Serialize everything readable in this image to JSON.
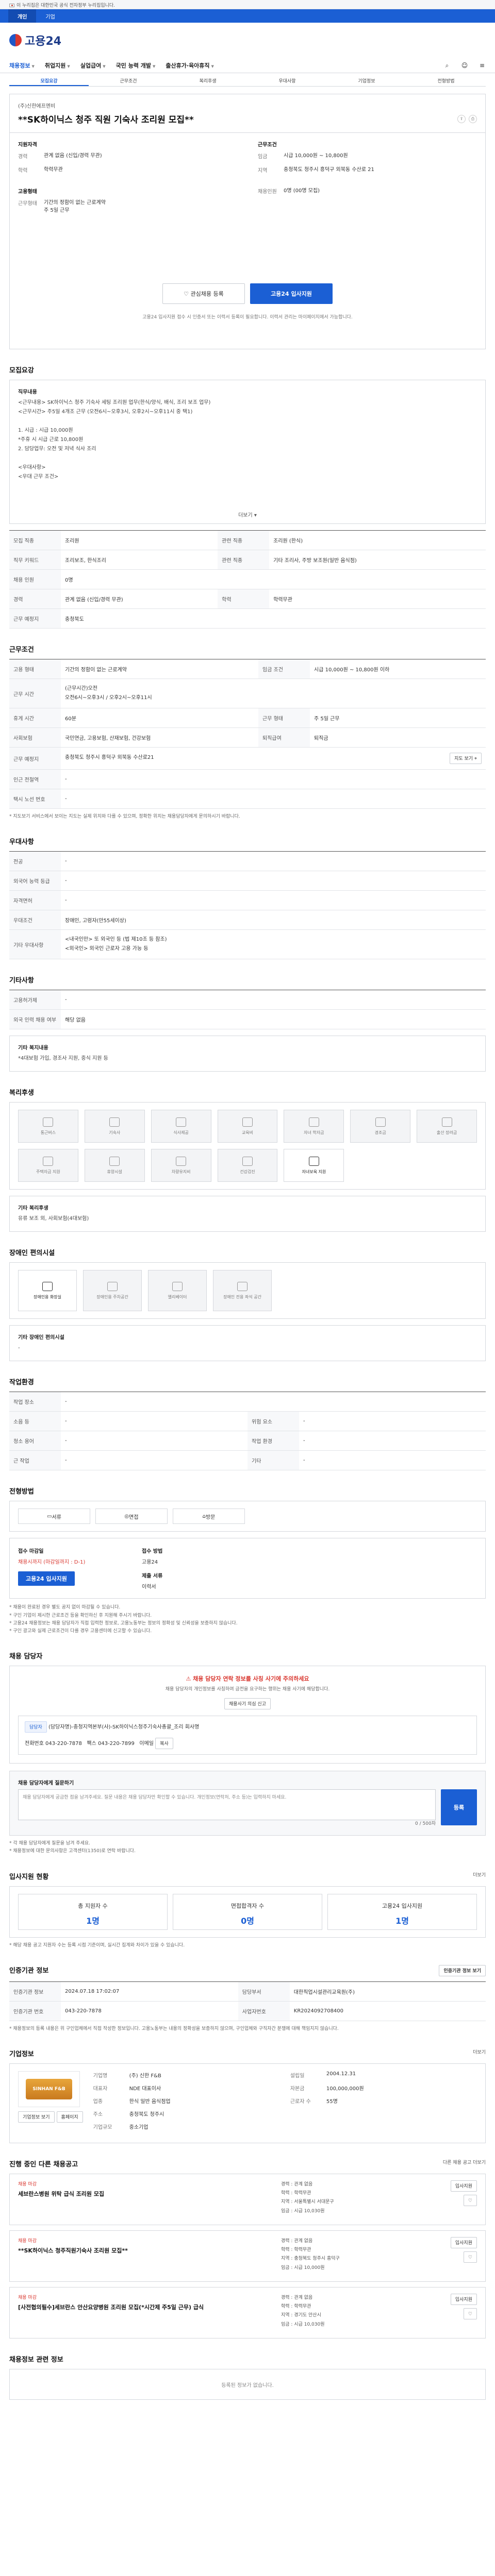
{
  "topbar": {
    "notice": "이 누리집은 대한민국 공식 전자정부 누리집입니다."
  },
  "blue_tabs": [
    "개인",
    "기업"
  ],
  "logo": {
    "text": "고용24"
  },
  "gnb": {
    "items": [
      "채용정보",
      "취업지원",
      "실업급여",
      "국민 능력 개발",
      "출산휴가·육아휴직"
    ],
    "right": [
      "검색",
      "로그인",
      "전체메뉴"
    ]
  },
  "anchor_tabs": [
    "모집요강",
    "근무조건",
    "복리후생",
    "우대사항",
    "기업정보",
    "전형방법"
  ],
  "job": {
    "company": "(주)신한에프엔비",
    "title": "**SK하이닉스 청주 직원 기숙사 조리원 모집**",
    "share": [
      "공유",
      "인쇄"
    ],
    "summary": {
      "left_head": "지원자격",
      "left": [
        {
          "k": "경력",
          "v": "관계 없음 (신입/경력 무관)"
        },
        {
          "k": "학력",
          "v": "학력무관"
        },
        {
          "k": "고용형태",
          "v": ""
        },
        {
          "k": "근무형태",
          "v": "기간의 정함이 없는 근로계약\n주 5일 근무"
        }
      ],
      "right_head": "근무조건",
      "right": [
        {
          "k": "임금",
          "v": "시급 10,000원 ~ 10,800원"
        },
        {
          "k": "지역",
          "v": "충청북도 청주시 흥덕구 외북동 수산로 21"
        },
        {
          "k": "채용인원",
          "v": "0명 (00명 모집)"
        }
      ],
      "bookmark_label": "관심채용 등록",
      "apply_label": "고용24 입사지원",
      "note": "고용24 입사지원 접수 시 인증서 또는 이력서 등록이 필요합니다. 이력서 관리는 마이페이지에서 가능합니다."
    }
  },
  "recruit": {
    "title": "모집요강",
    "duty_label": "직무내용",
    "duty_text": "<근무내용> SK하이닉스 청주 기숙사 세팅 조리원 업무(한식/양식, 배식, 조리 보조 업무)\n<근무시간> 주5일 4개조 근무 (오전6시~오후3시, 오후2시~오후11시 중 택1)\n\n1. 시급 : 시급 10,000원\n   *주휴 시 시급 근로 10,800원\n2. 담당업무: 오전 및 저녁 식사 조리\n\n<우대사항>\n<우대 근무 조건>",
    "more_label": "더보기",
    "rows": [
      [
        {
          "k": "모집 직종",
          "v": "조리원"
        },
        {
          "k": "관련 직종",
          "v": "조리원 (한식)"
        }
      ],
      [
        {
          "k": "직무 키워드",
          "v": "조리보조, 한식조리"
        },
        {
          "k": "관련 직종",
          "v": "기타 조리사, 주방 보조원(일반 음식점)"
        }
      ],
      [
        {
          "k": "채용 인원",
          "v": "0명"
        },
        {
          "k": "",
          "v": ""
        }
      ],
      [
        {
          "k": "경력",
          "v": "관계 없음 (신입/경력 무관)"
        },
        {
          "k": "학력",
          "v": "학력무관"
        }
      ],
      [
        {
          "k": "근무 예정지",
          "v": "충청북도"
        },
        {
          "k": "",
          "v": ""
        }
      ]
    ]
  },
  "condition": {
    "title": "근무조건",
    "rows": [
      [
        {
          "k": "고용 형태",
          "v": "기간의 정함이 없는 근로계약"
        },
        {
          "k": "임금 조건",
          "v": "시급 10,000원 ~ 10,800원 이하"
        }
      ],
      [
        {
          "k": "근무 시간",
          "v": "(근무시간)오전\n오전6시~오후3시 / 오후2시~오후11시"
        },
        {
          "k": "",
          "v": ""
        }
      ],
      [
        {
          "k": "휴게 시간",
          "v": "60분"
        },
        {
          "k": "근무 형태",
          "v": "주 5일 근무"
        }
      ],
      [
        {
          "k": "사회보험",
          "v": "국민연금, 고용보험, 산재보험, 건강보험"
        },
        {
          "k": "퇴직급여",
          "v": "퇴직금"
        }
      ],
      [
        {
          "k": "근무 예정지",
          "v": "충청북도 청주시 흥덕구 외북동 수산로21"
        },
        {
          "k": "",
          "v": ""
        }
      ],
      [
        {
          "k": "인근 전철역",
          "v": "-"
        },
        {
          "k": "",
          "v": ""
        }
      ],
      [
        {
          "k": "택시 노선 번호",
          "v": "-"
        },
        {
          "k": "",
          "v": ""
        }
      ]
    ],
    "map_label": "지도 보기",
    "note": "* 지도보기 서비스에서 보이는 지도는 실제 위치와 다를 수 있으며, 정확한 위치는 채용담당자에게 문의하시기 바랍니다."
  },
  "preference": {
    "title": "우대사항",
    "rows": [
      {
        "k": "전공",
        "v": "-"
      },
      {
        "k": "외국어 능력 등급",
        "v": "-"
      },
      {
        "k": "자격면허",
        "v": "-"
      },
      {
        "k": "우대조건",
        "v": "장애인, 고령자(만55세이상)"
      },
      {
        "k": "기타 우대사항",
        "v": "<내국인만> 또 외국인 등 (법 제10조 등 참조)\n<외국인> 외국인 근로자 고용 가능 등"
      }
    ]
  },
  "etc": {
    "title": "기타사항",
    "rows": [
      {
        "k": "고용허가제",
        "v": "-"
      },
      {
        "k": "외국 인력 채용 여부",
        "v": "해당 없음"
      }
    ],
    "etc_label": "기타 복지내용",
    "etc_text": "*4대보험 가입, 경조사 지원, 중식 지원 등"
  },
  "welfare": {
    "title": "복리후생",
    "items": [
      "통근버스",
      "기숙사",
      "식사제공",
      "교육비",
      "자녀 학자금",
      "경조금",
      "출산 장려금",
      "주택자금 지원",
      "휴양시설",
      "차량유지비",
      "건강검진",
      "자녀보육 지원"
    ],
    "active": [
      11
    ],
    "etc_label": "기타 복리후생",
    "etc_text": "유류 보조 외, 사회보험(4대보험)"
  },
  "disabled": {
    "title": "장애인 편의시설",
    "items": [
      "장애인용 화장실",
      "장애인용 주차공간",
      "엘리베이터",
      "장애인 전용 좌석 공간"
    ],
    "active": [
      0
    ],
    "etc_label": "기타 장애인 편의시설",
    "etc_text": "-"
  },
  "workplace": {
    "title": "작업환경",
    "rows": [
      {
        "k": "작업 장소",
        "v": "-",
        "k2": "",
        "v2": ""
      },
      {
        "k": "소음 등",
        "v": "-",
        "k2": "위험 요소",
        "v2": "-"
      },
      {
        "k": "청소 용어",
        "v": "-",
        "k2": "작업 환경",
        "v2": "-"
      },
      {
        "k": "근 작업",
        "v": "-",
        "k2": "기타",
        "v2": "-"
      }
    ]
  },
  "process": {
    "title": "전형방법",
    "methods": [
      "서류",
      "면접"
    ],
    "docs": [
      "방문"
    ]
  },
  "apply": {
    "deadline_label": "접수 마감일",
    "deadline_value": "채용시까지 (마감일까지 : D-1)",
    "method_label": "접수 방법",
    "method_value": "고용24",
    "apply_label": "고용24 입사지원",
    "doc_label": "제출 서류",
    "doc_value": "이력서",
    "notes": "* 채용이 완료된 경우 별도 공지 없이 마감될 수 있습니다.\n* 구인 기업이 제시한 근로조건 등을 확인하신 후 지원해 주시기 바랍니다.\n* 고용24 채용정보는 채용 담당자가 직접 입력한 정보로, 고용노동부는 정보의 정확성 및 신뢰성을 보증하지 않습니다.\n* 구인 광고와 실제 근로조건이 다를 경우 고용센터에 신고할 수 있습니다."
  },
  "contact": {
    "title": "채용 담당자",
    "alert_title": "채용 담당자 연락 정보를 사칭 사기에 주의하세요",
    "alert_text": "채용 담당자의 개인정보를 사칭하여 금전을 요구하는 행위는 채용 사기에 해당합니다.",
    "report_label": "채용사기 의심 신고",
    "badge": "담당자",
    "name": "(담당자명)-충청지역본부(사)-SK하이닉스청주기숙사총괄_조리 회사명",
    "phone_label": "전화번호",
    "phone_value": "043-220-7878",
    "fax_label": "팩스",
    "fax_value": "043-220-7899",
    "email_label": "이메일",
    "email_value": "",
    "copy_label": "복사"
  },
  "qna": {
    "title": "채용 담당자에게 질문하기",
    "placeholder": "채용 담당자에게 궁금한 점을 남겨주세요. 질문 내용은 채용 담당자만 확인할 수 있습니다. 개인정보(연락처, 주소 등)는 입력하지 마세요.",
    "count": "0 / 500자",
    "submit_label": "등록",
    "notes": "* 각 채용 담당자에게 질문을 남겨 주세요.\n* 채용정보에 대한 문의사항은 고객센터(1350)로 연락 바랍니다."
  },
  "stats": {
    "title": "입사지원 현황",
    "more_label": "더보기",
    "items": [
      {
        "k": "총 지원자 수",
        "v": "1명"
      },
      {
        "k": "면접합격자 수",
        "v": "0명"
      },
      {
        "k": "고용24 입사지원",
        "v": "1명"
      }
    ],
    "note": "* 해당 채용 공고 지원자 수는 등록 시점 기준이며, 실시간 집계와 차이가 있을 수 있습니다."
  },
  "info": {
    "title": "인증기관 정보",
    "rows": [
      {
        "k": "인증기관 정보",
        "v": "2024.07.18 17:02:07",
        "k2": "담당부서",
        "v2": "대한직업시설관리교육원(주)"
      },
      {
        "k": "인증기관 번호",
        "v": "043-220-7878",
        "k2": "사업자번호",
        "v2": "KR2024092708400"
      }
    ],
    "btn_label": "인증기관 정보 보기",
    "note": "* 채용정보의 등록 내용은 위 구인업체에서 직접 작성한 정보입니다. 고용노동부는 내용의 정확성을 보증하지 않으며, 구인업체와 구직자간 분쟁에 대해 책임지지 않습니다."
  },
  "company": {
    "title": "기업정보",
    "more_label": "더보기",
    "logo_text": "SINHAN F&B",
    "rows": [
      {
        "k": "기업명",
        "v": "(주) 신한 F&B",
        "k2": "설립일",
        "v2": "2004.12.31"
      },
      {
        "k": "대표자",
        "v": "NDE 대표이사",
        "k2": "자본금",
        "v2": "100,000,000원"
      },
      {
        "k": "업종",
        "v": "한식 일반 음식점업",
        "k2": "근로자 수",
        "v2": "55명"
      },
      {
        "k": "주소",
        "v": "충청북도 청주시",
        "k2": "",
        "v2": ""
      },
      {
        "k": "기업규모",
        "v": "중소기업",
        "k2": "",
        "v2": ""
      }
    ],
    "btn1": "기업정보 보기",
    "btn2": "홈페이지"
  },
  "others": {
    "title": "진행 중인 다른 채용공고",
    "more_label": "다른 채용 공고 더보기",
    "items": [
      {
        "co": "채용 마감",
        "title": "세브란스병원 위탁 급식 조리원 모집",
        "meta": "경력 : 관계 없음\n학력 : 학력무관\n지역 : 서울특별시 서대문구\n임금 : 시급 10,030원",
        "btn": "입사지원"
      },
      {
        "co": "채용 마감",
        "title": "**SK하이닉스 청주직원기숙사 조리원 모집**",
        "meta": "경력 : 관계 없음\n학력 : 학력무관\n지역 : 충청북도 청주시 흥덕구\n임금 : 시급 10,000원",
        "btn": "입사지원"
      },
      {
        "co": "채용 마감",
        "title": "[사전협의필수]세브란스 안산요양병원 조리원 모집(*시간제 주5일 근무) 급식",
        "meta": "경력 : 관계 없음\n학력 : 학력무관\n지역 : 경기도 안산시\n임금 : 시급 10,030원",
        "btn": "입사지원"
      }
    ]
  },
  "ad": {
    "title": "채용정보 관련 정보",
    "empty": "등록된 정보가 없습니다."
  }
}
